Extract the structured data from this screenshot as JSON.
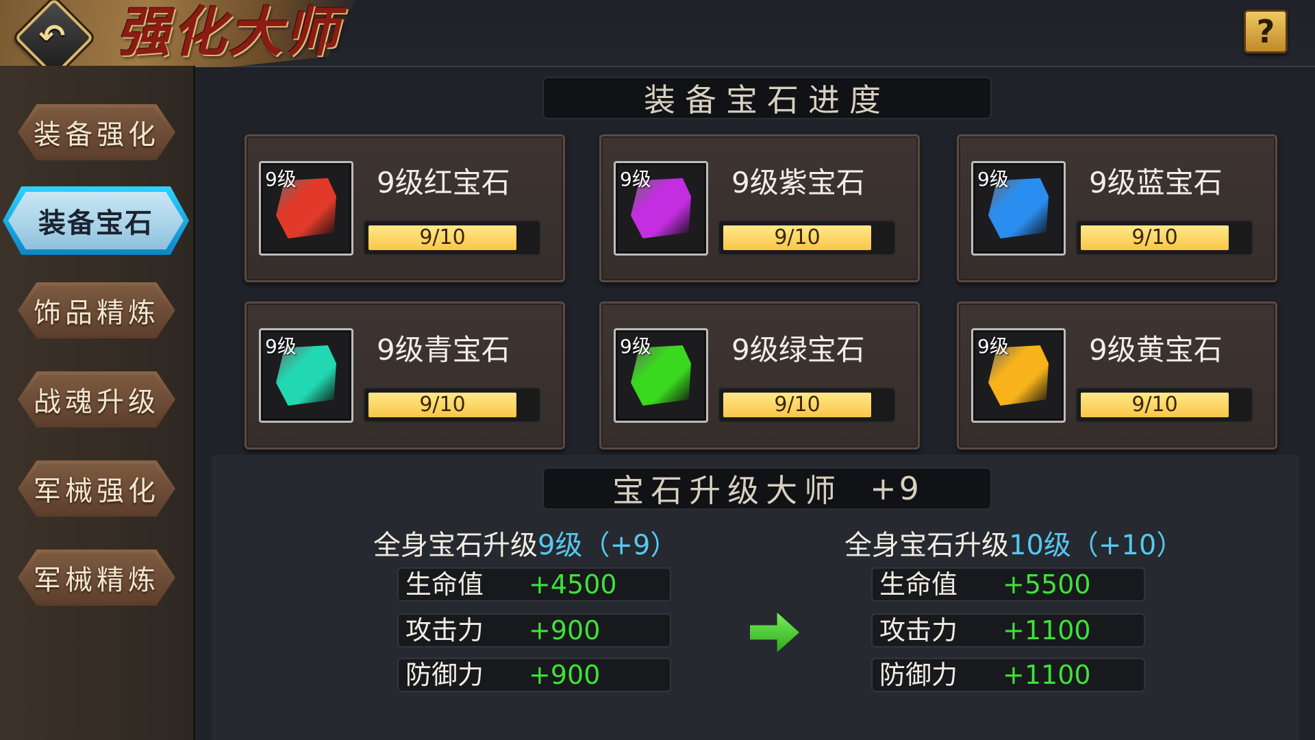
{
  "header": {
    "title": "强化大师",
    "back_icon": "back-arrow-icon",
    "help_label": "?"
  },
  "sidebar": {
    "items": [
      {
        "label": "装备强化",
        "active": false
      },
      {
        "label": "装备宝石",
        "active": true
      },
      {
        "label": "饰品精炼",
        "active": false
      },
      {
        "label": "战魂升级",
        "active": false
      },
      {
        "label": "军械强化",
        "active": false
      },
      {
        "label": "军械精炼",
        "active": false
      }
    ]
  },
  "progress_section": {
    "title": "装备宝石进度",
    "gems": [
      {
        "level_badge": "9级",
        "name": "9级红宝石",
        "progress_text": "9/10",
        "progress": 0.9,
        "color": "#e23a2a",
        "icon": "red-gem-icon"
      },
      {
        "level_badge": "9级",
        "name": "9级紫宝石",
        "progress_text": "9/10",
        "progress": 0.9,
        "color": "#c22ee0",
        "icon": "purple-gem-icon"
      },
      {
        "level_badge": "9级",
        "name": "9级蓝宝石",
        "progress_text": "9/10",
        "progress": 0.9,
        "color": "#2a8ef0",
        "icon": "blue-gem-icon"
      },
      {
        "level_badge": "9级",
        "name": "9级青宝石",
        "progress_text": "9/10",
        "progress": 0.9,
        "color": "#22d8b2",
        "icon": "cyan-gem-icon"
      },
      {
        "level_badge": "9级",
        "name": "9级绿宝石",
        "progress_text": "9/10",
        "progress": 0.9,
        "color": "#3ad81e",
        "icon": "green-gem-icon"
      },
      {
        "level_badge": "9级",
        "name": "9级黄宝石",
        "progress_text": "9/10",
        "progress": 0.9,
        "color": "#f8b21a",
        "icon": "yellow-gem-icon"
      }
    ]
  },
  "master_section": {
    "title": "宝石升级大师",
    "bonus": "+9",
    "current": {
      "prefix": "全身宝石升级",
      "highlight": "9级（+9）",
      "stats": [
        {
          "label": "生命值",
          "value": "+4500"
        },
        {
          "label": "攻击力",
          "value": "+900"
        },
        {
          "label": "防御力",
          "value": "+900"
        }
      ]
    },
    "next": {
      "prefix": "全身宝石升级",
      "highlight": "10级（+10）",
      "stats": [
        {
          "label": "生命值",
          "value": "+5500"
        },
        {
          "label": "攻击力",
          "value": "+1100"
        },
        {
          "label": "防御力",
          "value": "+1100"
        }
      ]
    },
    "arrow_icon": "right-arrow-icon"
  }
}
